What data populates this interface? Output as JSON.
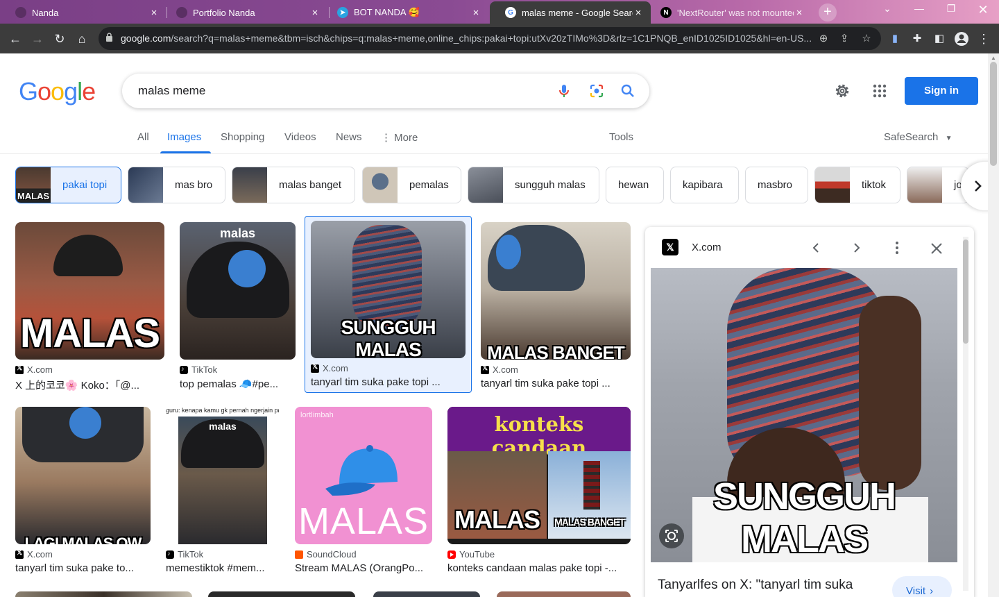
{
  "browser": {
    "tabs": [
      {
        "title": "Nanda",
        "active": false
      },
      {
        "title": "Portfolio Nanda",
        "active": false
      },
      {
        "title": "BOT NANDA 🥰",
        "active": false
      },
      {
        "title": "malas meme - Google Search",
        "active": true
      },
      {
        "title": "'NextRouter' was not mounted",
        "active": false
      }
    ],
    "url_host": "google.com",
    "url_rest": "/search?q=malas+meme&tbm=isch&chips=q:malas+meme,online_chips:pakai+topi:utXv20zTIMo%3D&rlz=1C1PNQB_enID1025ID1025&hl=en-US..."
  },
  "header": {
    "logo": "Google",
    "query": "malas meme",
    "signin_label": "Sign in"
  },
  "nav": {
    "tabs": [
      "All",
      "Images",
      "Shopping",
      "Videos",
      "News",
      "More"
    ],
    "tools_label": "Tools",
    "safesearch_label": "SafeSearch"
  },
  "chips": [
    "pakai topi",
    "mas bro",
    "malas banget",
    "pemalas",
    "sungguh malas",
    "hewan",
    "kapibara",
    "masbro",
    "tiktok",
    "jo"
  ],
  "results": [
    {
      "source": "X.com",
      "caption": "X 上的코코🌸 Koko：「@...",
      "meme": "MALAS"
    },
    {
      "source": "TikTok",
      "caption": "top pemalas 🧢#pe...",
      "meme": "malas"
    },
    {
      "source": "X.com",
      "caption": "tanyarl tim suka pake topi ...",
      "meme": "SUNGGUH MALAS"
    },
    {
      "source": "X.com",
      "caption": "tanyarl tim suka pake topi ...",
      "meme": "MALAS BANGET"
    },
    {
      "source": "X.com",
      "caption": "tanyarl tim suka pake to...",
      "meme": "LAGI MALAS OW"
    },
    {
      "source": "TikTok",
      "caption": "memestiktok #mem...",
      "meme": "malas",
      "overlay": "guru: kenapa kamu gk pernah ngerjain pr?"
    },
    {
      "source": "SoundCloud",
      "caption": "Stream MALAS (OrangPo...",
      "meme": "MALAS",
      "uploader": "lortlimbah"
    },
    {
      "source": "YouTube",
      "caption": "konteks candaan malas pake topi -...",
      "meme": "konteks candaan",
      "sub1": "MALAS",
      "sub2": "MALAS BANGET"
    }
  ],
  "preview": {
    "source": "X.com",
    "meme": "SUNGGUH MALAS",
    "title": "Tanyarlfes on X: \"tanyarl tim suka",
    "visit_label": "Visit"
  }
}
